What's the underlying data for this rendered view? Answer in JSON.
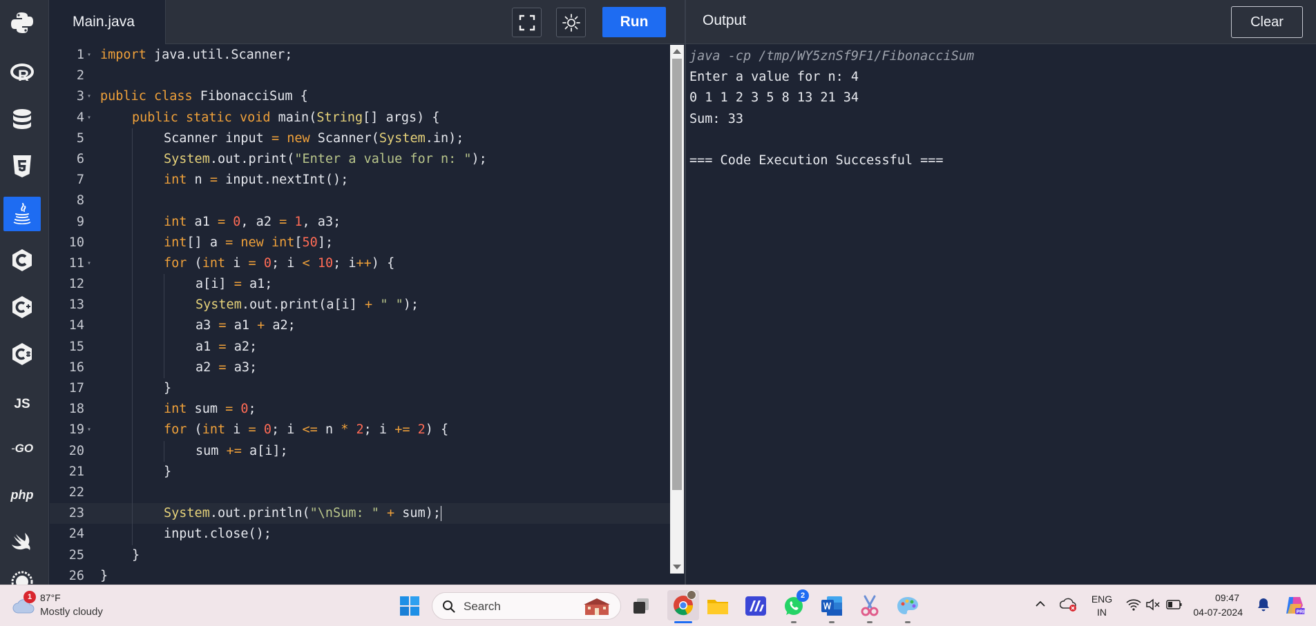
{
  "sidebar": {
    "languages": [
      "python-icon",
      "r-icon",
      "sql-icon",
      "html5-icon",
      "java-icon",
      "c-icon",
      "cpp-icon",
      "csharp-icon",
      "js-icon",
      "go-icon",
      "php-icon",
      "swift-icon",
      "rust-icon"
    ],
    "js_label": "JS",
    "go_label": "GO",
    "php_label": "php",
    "active": "java-icon"
  },
  "editor": {
    "file_name": "Main.java",
    "run_label": "Run",
    "line_numbers": [
      "1",
      "2",
      "3",
      "4",
      "5",
      "6",
      "7",
      "8",
      "9",
      "10",
      "11",
      "12",
      "13",
      "14",
      "15",
      "16",
      "17",
      "18",
      "19",
      "20",
      "21",
      "22",
      "23",
      "24",
      "25",
      "26"
    ],
    "code": {
      "l1": [
        "import",
        " java.util.Scanner;"
      ],
      "l3": [
        "public",
        " ",
        "class",
        " FibonacciSum {"
      ],
      "l4": [
        "public",
        " ",
        "static",
        " ",
        "void",
        " main(",
        "String",
        "[] args) {"
      ],
      "l5": [
        "Scanner input ",
        "=",
        " ",
        "new",
        " Scanner(",
        "System",
        ".in);"
      ],
      "l6": [
        "System",
        ".out.print(",
        "\"Enter a value for n: \"",
        ");"
      ],
      "l7": [
        "int",
        " n ",
        "=",
        " input.nextInt();"
      ],
      "l9": [
        "int",
        " a1 ",
        "=",
        " ",
        "0",
        ", a2 ",
        "=",
        " ",
        "1",
        ", a3;"
      ],
      "l10": [
        "int",
        "[] a ",
        "=",
        " ",
        "new",
        " ",
        "int",
        "[",
        "50",
        "];"
      ],
      "l11": [
        "for",
        " (",
        "int",
        " i ",
        "=",
        " ",
        "0",
        "; i ",
        "<",
        " ",
        "10",
        "; i",
        "++",
        ") {"
      ],
      "l12": [
        "a[i] ",
        "=",
        " a1;"
      ],
      "l13": [
        "System",
        ".out.print(a[i] ",
        "+",
        " ",
        "\" \"",
        ");"
      ],
      "l14": [
        "a3 ",
        "=",
        " a1 ",
        "+",
        " a2;"
      ],
      "l15": [
        "a1 ",
        "=",
        " a2;"
      ],
      "l16": [
        "a2 ",
        "=",
        " a3;"
      ],
      "l17": [
        "}"
      ],
      "l18": [
        "int",
        " sum ",
        "=",
        " ",
        "0",
        ";"
      ],
      "l19": [
        "for",
        " (",
        "int",
        " i ",
        "=",
        " ",
        "0",
        "; i ",
        "<=",
        " n ",
        "*",
        " ",
        "2",
        "; i ",
        "+=",
        " ",
        "2",
        ") {"
      ],
      "l20": [
        "sum ",
        "+=",
        " a[i];"
      ],
      "l21": [
        "}"
      ],
      "l23": [
        "System",
        ".out.println(",
        "\"\\nSum: \"",
        " ",
        "+",
        " sum);"
      ],
      "l24": [
        "input.close();"
      ],
      "l25": [
        "}"
      ],
      "l26": [
        "}"
      ]
    }
  },
  "output": {
    "title": "Output",
    "clear_label": "Clear",
    "lines": [
      "java -cp /tmp/WY5znSf9F1/FibonacciSum",
      "Enter a value for n: 4",
      "0 1 1 2 3 5 8 13 21 34",
      "Sum: 33",
      "",
      "=== Code Execution Successful ==="
    ]
  },
  "taskbar": {
    "weather_badge": "1",
    "weather_temp": "87°F",
    "weather_desc": "Mostly cloudy",
    "search_label": "Search",
    "whatsapp_badge": "2",
    "lang_line1": "ENG",
    "lang_line2": "IN",
    "time": "09:47",
    "date": "04-07-2024"
  },
  "colors": {
    "accent": "#1e6cf2",
    "editor_bg": "#1e2433",
    "keyword": "#f0a13a",
    "type": "#e6d27a",
    "string": "#b9c68b",
    "number": "#ff6b55"
  }
}
